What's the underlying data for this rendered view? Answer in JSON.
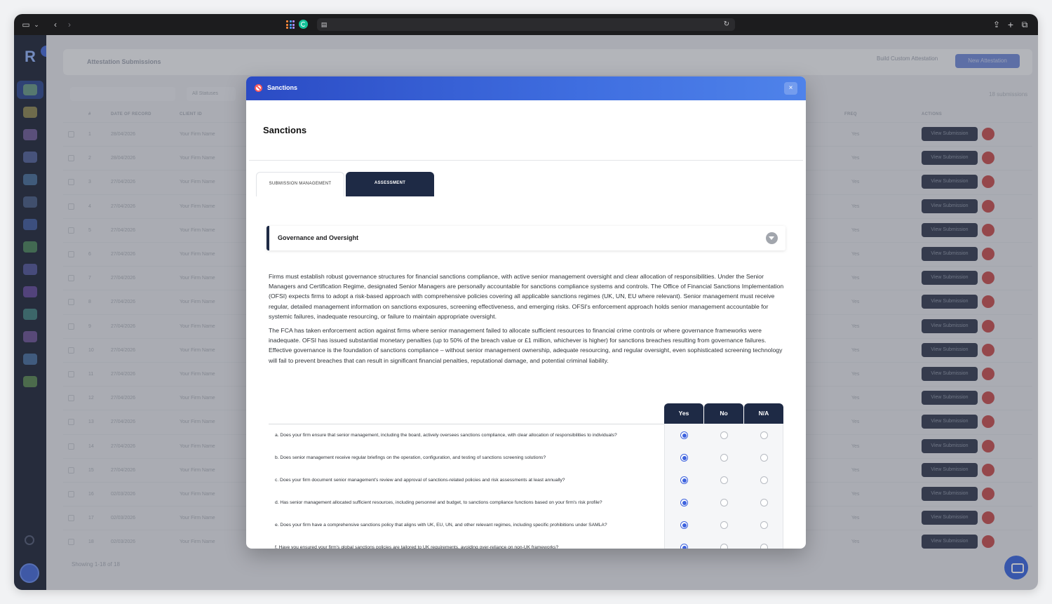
{
  "bg": {
    "page_title": "Attestation Submissions",
    "build_custom": "Build Custom Attestation",
    "new_button": "New Attestation",
    "filter": "All Statuses",
    "count": "18 submissions",
    "headers": [
      "#",
      "DATE OF RECORD",
      "CLIENT ID",
      "FREQ",
      "ACTIONS"
    ],
    "dates": [
      "28/04/2026",
      "28/04/2026",
      "27/04/2026",
      "27/04/2026",
      "27/04/2026",
      "27/04/2026",
      "27/04/2026",
      "27/04/2026",
      "27/04/2026",
      "27/04/2026",
      "27/04/2026",
      "27/04/2026",
      "27/04/2026",
      "27/04/2026",
      "27/04/2026",
      "02/03/2026",
      "02/03/2026",
      "02/03/2026"
    ],
    "client": "Your Firm Name",
    "freq": "Yes",
    "view_label": "View Submission",
    "footer": "Showing 1-18 of 18"
  },
  "modal": {
    "title": "Sanctions",
    "close": "×",
    "heading": "Sanctions",
    "tabs": [
      "SUBMISSION MANAGEMENT",
      "ASSESSMENT"
    ],
    "section_title": "Governance and Oversight",
    "paragraphs": [
      "Firms must establish robust governance structures for financial sanctions compliance, with active senior management oversight and clear allocation of responsibilities. Under the Senior Managers and Certification Regime, designated Senior Managers are personally accountable for sanctions compliance systems and controls. The Office of Financial Sanctions Implementation (OFSI) expects firms to adopt a risk-based approach with comprehensive policies covering all applicable sanctions regimes (UK, UN, EU where relevant). Senior management must receive regular, detailed management information on sanctions exposures, screening effectiveness, and emerging risks. OFSI's enforcement approach holds senior management accountable for systemic failures, inadequate resourcing, or failure to maintain appropriate oversight.",
      "The FCA has taken enforcement action against firms where senior management failed to allocate sufficient resources to financial crime controls or where governance frameworks were inadequate. OFSI has issued substantial monetary penalties (up to 50% of the breach value or £1 million, whichever is higher) for sanctions breaches resulting from governance failures. Effective governance is the foundation of sanctions compliance – without senior management ownership, adequate resourcing, and regular oversight, even sophisticated screening technology will fail to prevent breaches that can result in significant financial penalties, reputational damage, and potential criminal liability."
    ],
    "columns": [
      "Yes",
      "No",
      "N/A"
    ],
    "questions": [
      {
        "text": "a. Does your firm ensure that senior management, including the board, actively oversees sanctions compliance, with clear allocation of responsibilities to individuals?",
        "answer": "Yes"
      },
      {
        "text": "b. Does senior management receive regular briefings on the operation, configuration, and testing of sanctions screening solutions?",
        "answer": "Yes"
      },
      {
        "text": "c. Does your firm document senior management's review and approval of sanctions-related policies and risk assessments at least annually?",
        "answer": "Yes"
      },
      {
        "text": "d. Has senior management allocated sufficient resources, including personnel and budget, to sanctions compliance functions based on your firm's risk profile?",
        "answer": "Yes"
      },
      {
        "text": "e. Does your firm have a comprehensive sanctions policy that aligns with UK, EU, UN, and other relevant regimes, including specific prohibitions under SAMLA?",
        "answer": "Yes"
      },
      {
        "text": "f. Have you ensured your firm's global sanctions policies are tailored to UK requirements, avoiding over-reliance on non-UK frameworks?",
        "answer": "Yes"
      }
    ]
  },
  "colors": {
    "header_start": "#2b4bc4",
    "header_end": "#4f83ea",
    "navy": "#1e2a45",
    "radio_selected": "#3e63de",
    "sidebar": "#121b2e"
  },
  "icons": [
    "sidebar-toggle-icon",
    "chevron-down-icon",
    "back-icon",
    "forward-icon",
    "apps-grid-icon",
    "grammarly-icon",
    "page-icon",
    "reload-icon",
    "share-icon",
    "new-tab-icon",
    "tabs-overview-icon",
    "sanctions-ban-icon",
    "close-icon",
    "collapse-arrow-icon",
    "chat-icon"
  ]
}
